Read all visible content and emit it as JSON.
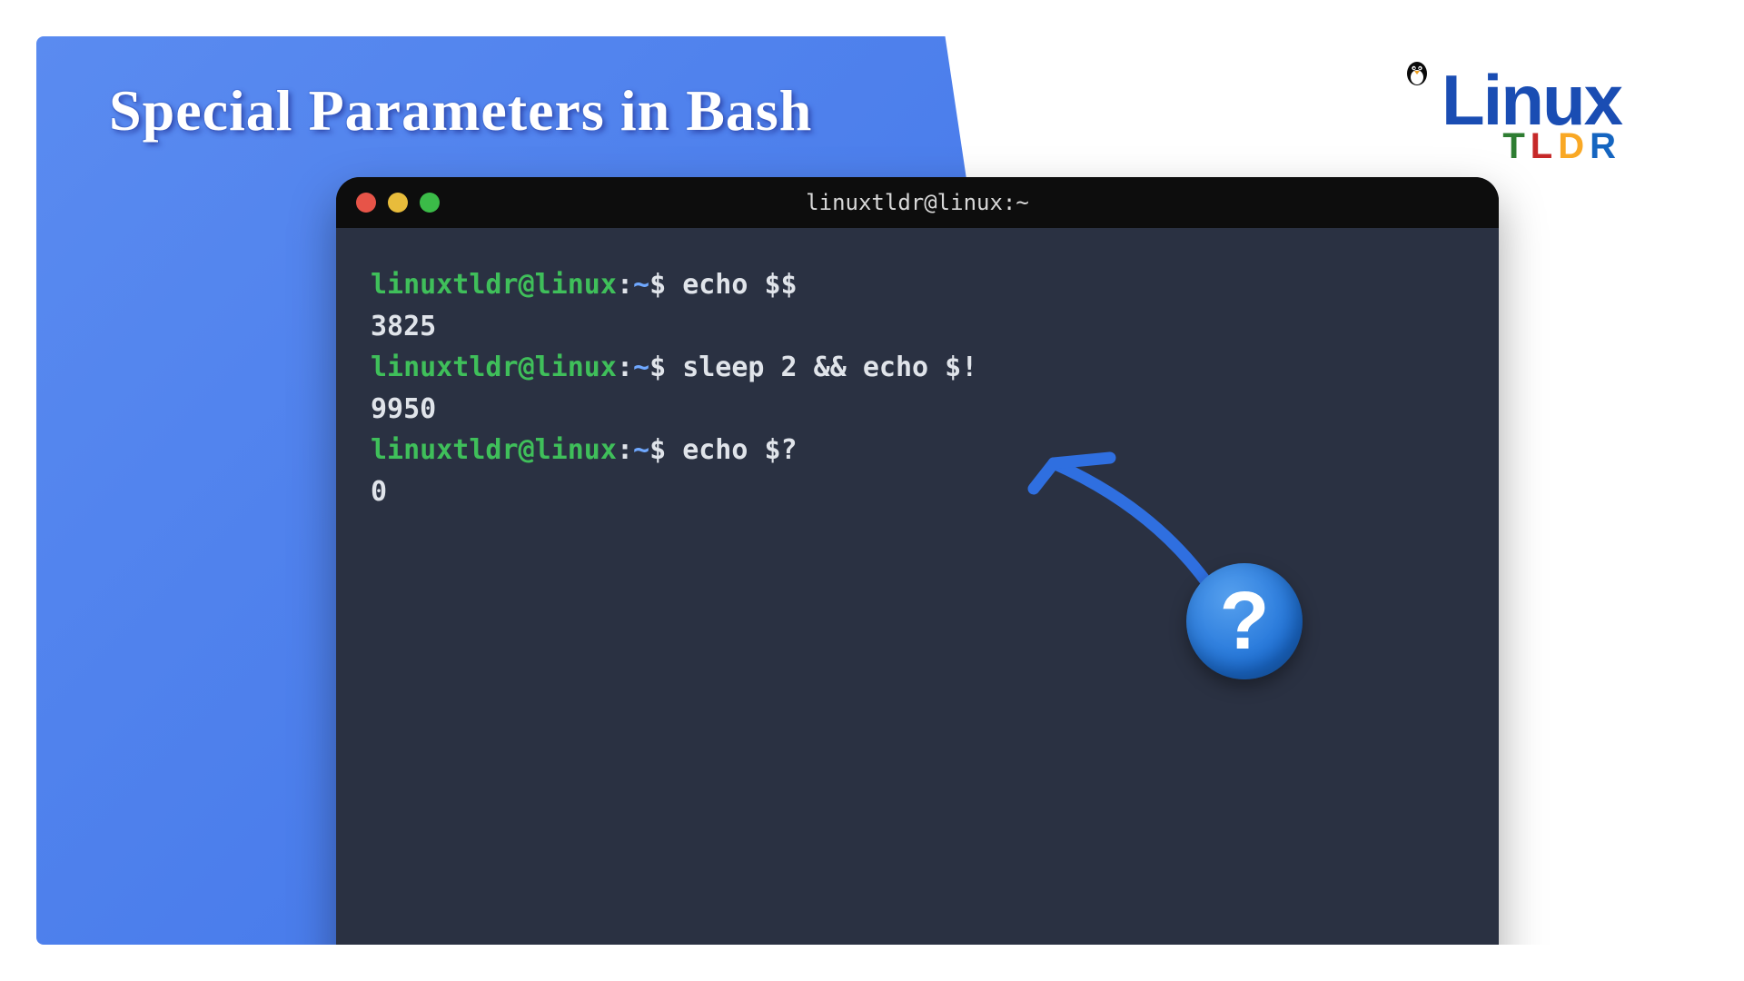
{
  "title": "Special Parameters in Bash",
  "logo": {
    "main": "Linux",
    "sub": {
      "t": "T",
      "l": "L",
      "d": "D",
      "r": "R"
    }
  },
  "terminal": {
    "titlebar": "linuxtldr@linux:~",
    "prompt": {
      "user": "linuxtldr@linux",
      "colon": ":",
      "path": "~",
      "dollar": "$"
    },
    "lines": [
      {
        "cmd": "echo $$",
        "out": "3825"
      },
      {
        "cmd": "sleep 2 && echo $!",
        "out": "9950"
      },
      {
        "cmd": "echo $?",
        "out": "0"
      }
    ]
  },
  "badge": {
    "symbol": "?"
  },
  "colors": {
    "blue_grad_start": "#5a8bf0",
    "blue_grad_end": "#3f73e8",
    "terminal_bg": "#2a3142",
    "prompt_green": "#3fbf5a",
    "logo_blue": "#1a4db3"
  }
}
